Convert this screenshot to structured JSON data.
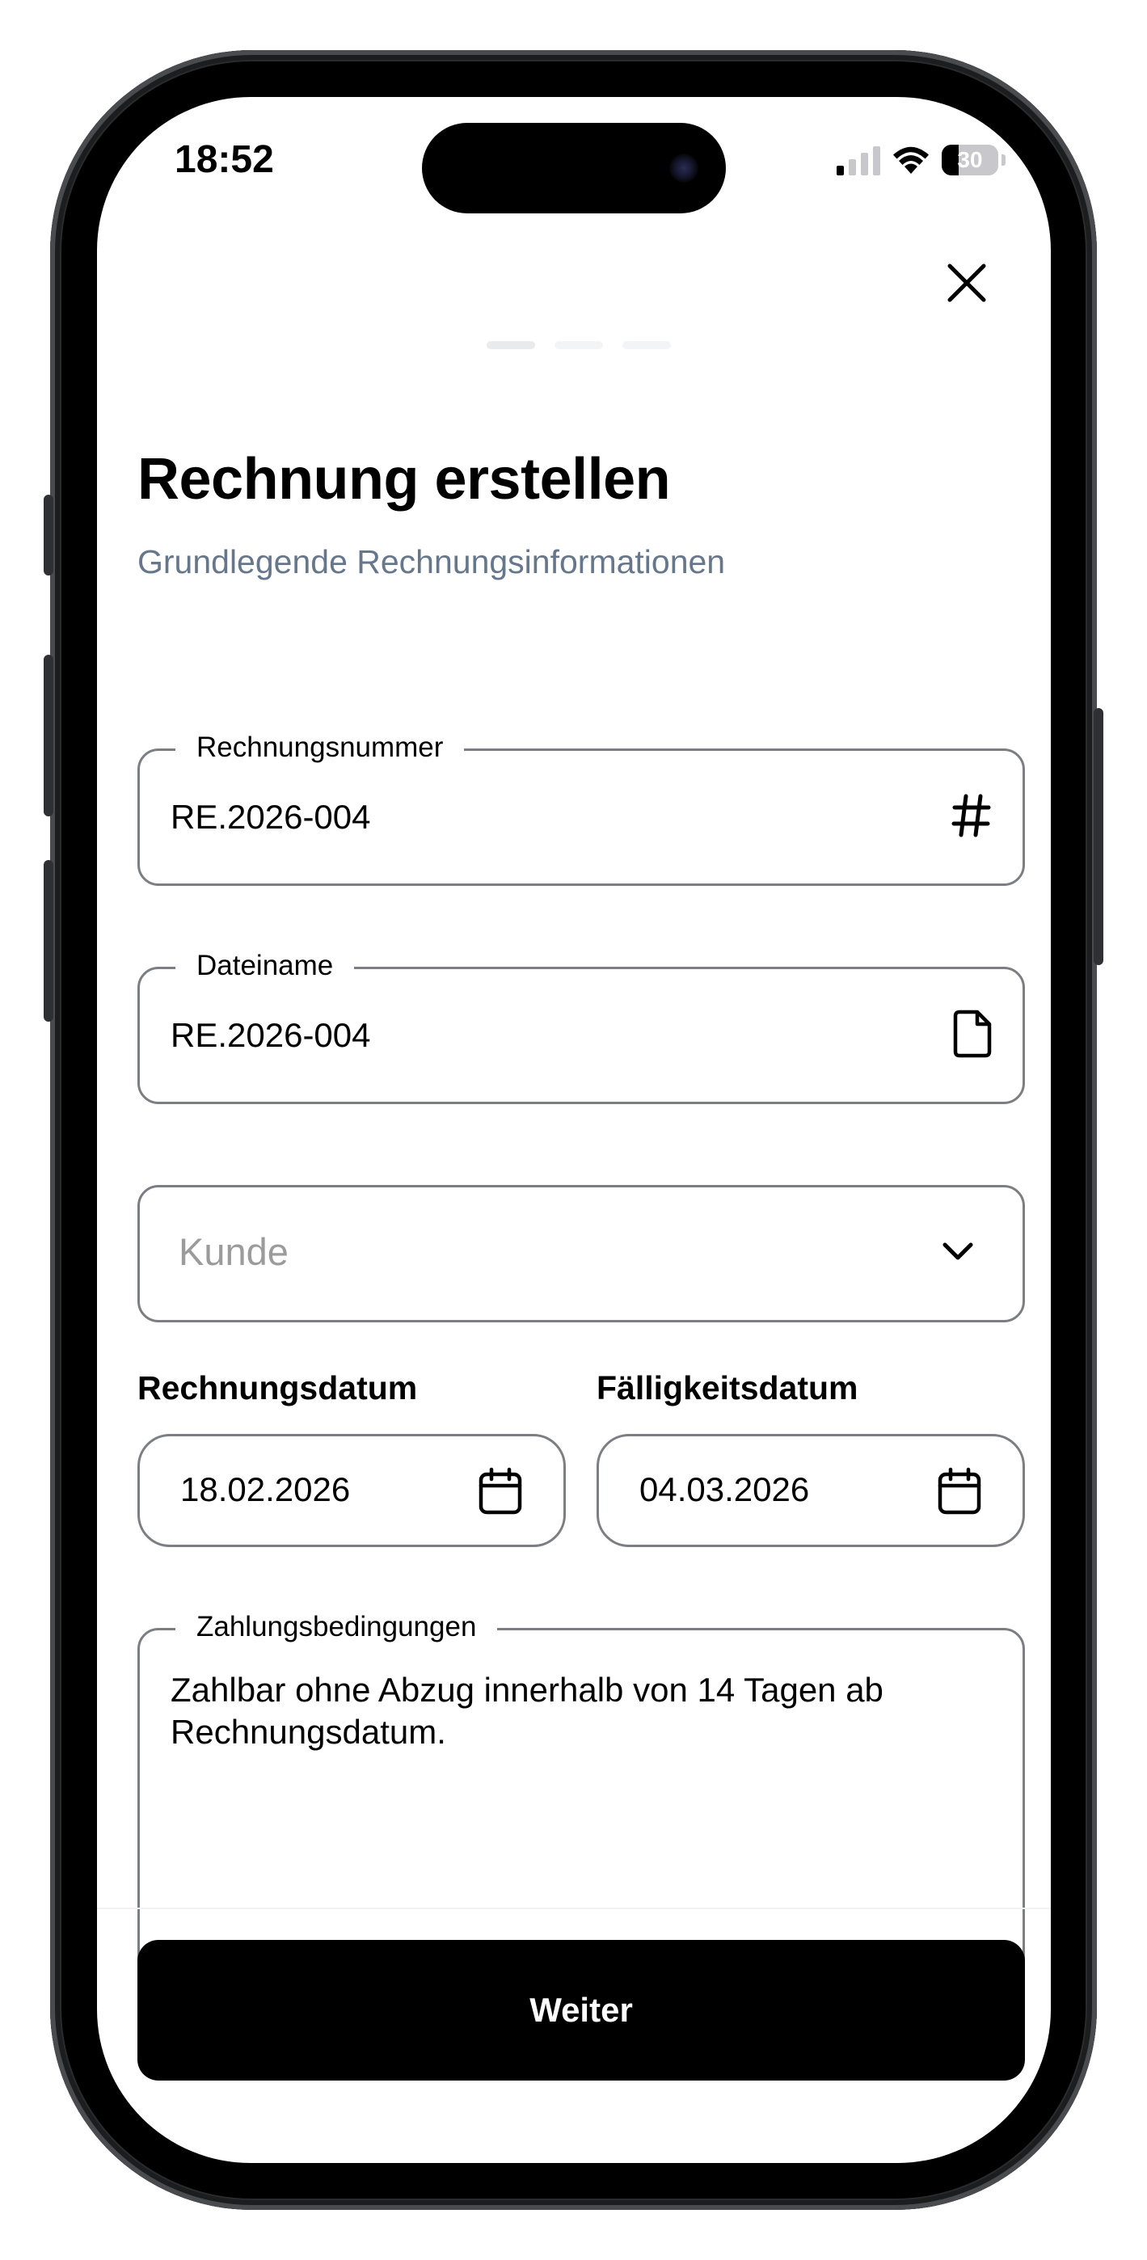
{
  "status_bar": {
    "time": "18:52",
    "battery_text": "30",
    "battery_level": 0.3,
    "signal_bars_on": 1,
    "signal_bars_total": 4
  },
  "header": {
    "close_icon": "close-icon",
    "steps_total": 3,
    "current_step": 1
  },
  "form": {
    "title": "Rechnung erstellen",
    "subtitle": "Grundlegende Rechnungsinformationen",
    "invoice_number": {
      "label": "Rechnungsnummer",
      "value": "RE.2026-004",
      "icon": "hash-icon"
    },
    "file_name": {
      "label": "Dateiname",
      "value": "RE.2026-004",
      "icon": "file-icon"
    },
    "customer": {
      "placeholder": "Kunde",
      "icon": "chevron-down-icon"
    },
    "invoice_date": {
      "label": "Rechnungsdatum",
      "value": "18.02.2026",
      "icon": "calendar-icon"
    },
    "due_date": {
      "label": "Fälligkeitsdatum",
      "value": "04.03.2026",
      "icon": "calendar-icon"
    },
    "payment_terms": {
      "label": "Zahlungsbedingungen",
      "value": "Zahlbar ohne Abzug innerhalb von 14 Tagen ab Rechnungsdatum."
    }
  },
  "footer": {
    "next_label": "Weiter"
  },
  "colors": {
    "subtitle": "#66778c",
    "border": "#7b7e82",
    "placeholder": "#9b9b9b",
    "button_bg": "#000000",
    "button_text": "#ffffff"
  }
}
